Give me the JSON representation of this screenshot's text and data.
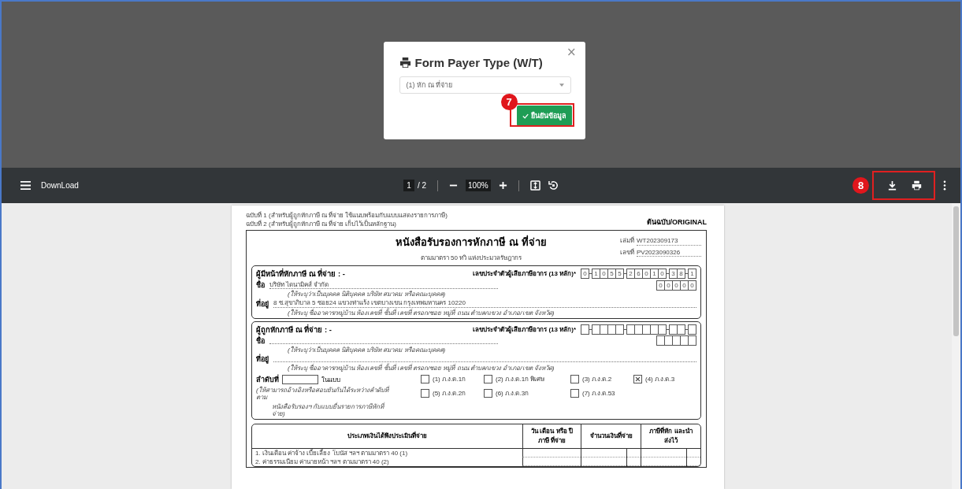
{
  "dialog": {
    "title": "Form Payer Type (W/T)",
    "close": "×",
    "select_value": "(1) หัก ณ ที่จ่าย",
    "confirm_button": "ยืนยันข้อมูล",
    "step": "7"
  },
  "toolbar": {
    "title": "DownLoad",
    "page": "1",
    "page_total": "/ 2",
    "zoom": "100%",
    "step": "8"
  },
  "document": {
    "copy_notes": [
      "ฉบับที่ 1 (สำหรับผู้ถูกหักภาษี ณ ที่จ่าย ใช้แนบพร้อมกับแบบแสดงรายการภาษี)",
      "ฉบับที่ 2 (สำหรับผู้ถูกหักภาษี ณ ที่จ่าย เก็บไว้เป็นหลักฐาน)"
    ],
    "original_label": "ต้นฉบับ/ORIGINAL",
    "title": "หนังสือรับรองการหักภาษี ณ ที่จ่าย",
    "subtitle": "ตามมาตรา 50 ทวิ แห่งประมวลรัษฎากร",
    "book_no": {
      "label": "เล่มที่",
      "value": "WT202309173"
    },
    "number": {
      "label": "เลขที่",
      "value": "PV2023090326"
    },
    "payer": {
      "heading": "ผู้มีหน้าที่หักภาษี ณ ที่จ่าย : -",
      "tax_id_label": "เลขประจำตัวผู้เสียภาษีอากร (13 หลัก)*",
      "tax_id_digits": [
        "0",
        "1",
        "0",
        "5",
        "5",
        "2",
        "6",
        "0",
        "1",
        "0",
        "3",
        "8",
        "1"
      ],
      "branch_digits": [
        "0",
        "0",
        "0",
        "0",
        "0"
      ],
      "name_label": "ชื่อ",
      "name": "บริษัท ไดนามิคส์ จำกัด",
      "name_hint": "(ให้ระบุว่าเป็นบุคคล นิติบุคคล บริษัท สมาคม หรือคณะบุคคล)",
      "address_label": "ที่อยู่",
      "address": "8 ซ.สุขาภิบาล 5 ซอย24 แขวงท่าแร้ง เขตบางเขน กรุงเทพมหานคร 10220",
      "address_hint": "(ให้ระบุ ชื่ออาคาร/หมู่บ้าน ห้องเลขที่ ชั้นที่ เลขที่ ตรอก/ซอย หมู่ที่ ถนน ตำบล/แขวง อำเภอ/เขต จังหวัด)"
    },
    "payee": {
      "heading": "ผู้ถูกหักภาษี ณ ที่จ่าย : -",
      "tax_id_label": "เลขประจำตัวผู้เสียภาษีอากร (13 หลัก)*",
      "name_label": "ชื่อ",
      "name_hint": "(ให้ระบุว่าเป็นบุคคล นิติบุคคล บริษัท สมาคม หรือคณะบุคคล)",
      "address_label": "ที่อยู่",
      "address_hint": "(ให้ระบุ ชื่ออาคาร/หมู่บ้าน ห้องเลขที่ ชั้นที่ เลขที่ ตรอก/ซอย หมู่ที่ ถนน ตำบล/แขวง อำเภอ/เขต จังหวัด)"
    },
    "order": {
      "label": "ลำดับที่",
      "suffix": "ในแบบ",
      "hint_lines": [
        "(ให้สามารถอ้างอิงหรือสอบยันกันได้ระหว่างลำดับที่ตาม",
        "หนังสือรับรองฯ กับแบบยื่นรายการภาษีหักที่จ่าย)"
      ]
    },
    "forms": [
      {
        "label": "(1) ภ.ง.ด.1ก",
        "checked": false
      },
      {
        "label": "(2) ภ.ง.ด.1ก พิเศษ",
        "checked": false
      },
      {
        "label": "(3) ภ.ง.ด.2",
        "checked": false
      },
      {
        "label": "(4) ภ.ง.ด.3",
        "checked": true
      },
      {
        "label": "(5) ภ.ง.ด.2ก",
        "checked": false
      },
      {
        "label": "(6) ภ.ง.ด.3ก",
        "checked": false
      },
      {
        "label": "(7) ภ.ง.ด.53",
        "checked": false
      }
    ],
    "income_table": {
      "columns": [
        "ประเภทเงินได้พึงประเมินที่จ่าย",
        "วัน เดือน หรือ ปีภาษี ที่จ่าย",
        "จำนวนเงินที่จ่าย",
        "ภาษีที่หัก และนำส่งไว้"
      ],
      "rows": [
        "1. เงินเดือน ค่าจ้าง เบี้ยเลี้ยง โบนัส ฯลฯ ตามมาตรา 40 (1)",
        "2. ค่าธรรมเนียม ค่านายหน้า ฯลฯ ตามมาตรา 40 (2)"
      ]
    }
  }
}
